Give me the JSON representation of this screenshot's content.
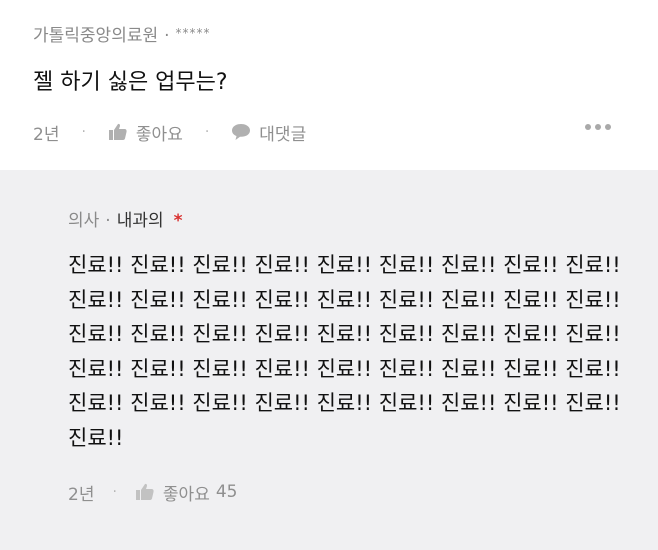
{
  "post": {
    "hospital": "가톨릭중앙의료원",
    "separator": "·",
    "stars": "*****",
    "title": "젤 하기 싫은 업무는?",
    "time": "2년",
    "like_label": "좋아요",
    "comment_label": "대댓글",
    "icons": [
      "thumbs-up-icon",
      "comment-bubble-icon",
      "more-dots-icon"
    ]
  },
  "comment": {
    "role": "의사",
    "separator": "·",
    "department": "내과의",
    "required_mark": "*",
    "body": "진료!! 진료!! 진료!! 진료!! 진료!! 진료!! 진료!! 진료!! 진료!! 진료!! 진료!! 진료!! 진료!! 진료!! 진료!! 진료!! 진료!! 진료!! 진료!! 진료!! 진료!! 진료!! 진료!! 진료!! 진료!! 진료!! 진료!! 진료!! 진료!! 진료!! 진료!! 진료!! 진료!! 진료!! 진료!! 진료!! 진료!! 진료!! 진료!! 진료!! 진료!! 진료!! 진료!! 진료!! 진료!! 진료!!",
    "time": "2년",
    "like_label": "좋아요",
    "like_count": "45"
  },
  "colors": {
    "comment_background": "#f0f0f2",
    "muted_text": "#8a8a8a",
    "required_mark": "#d8302f"
  }
}
